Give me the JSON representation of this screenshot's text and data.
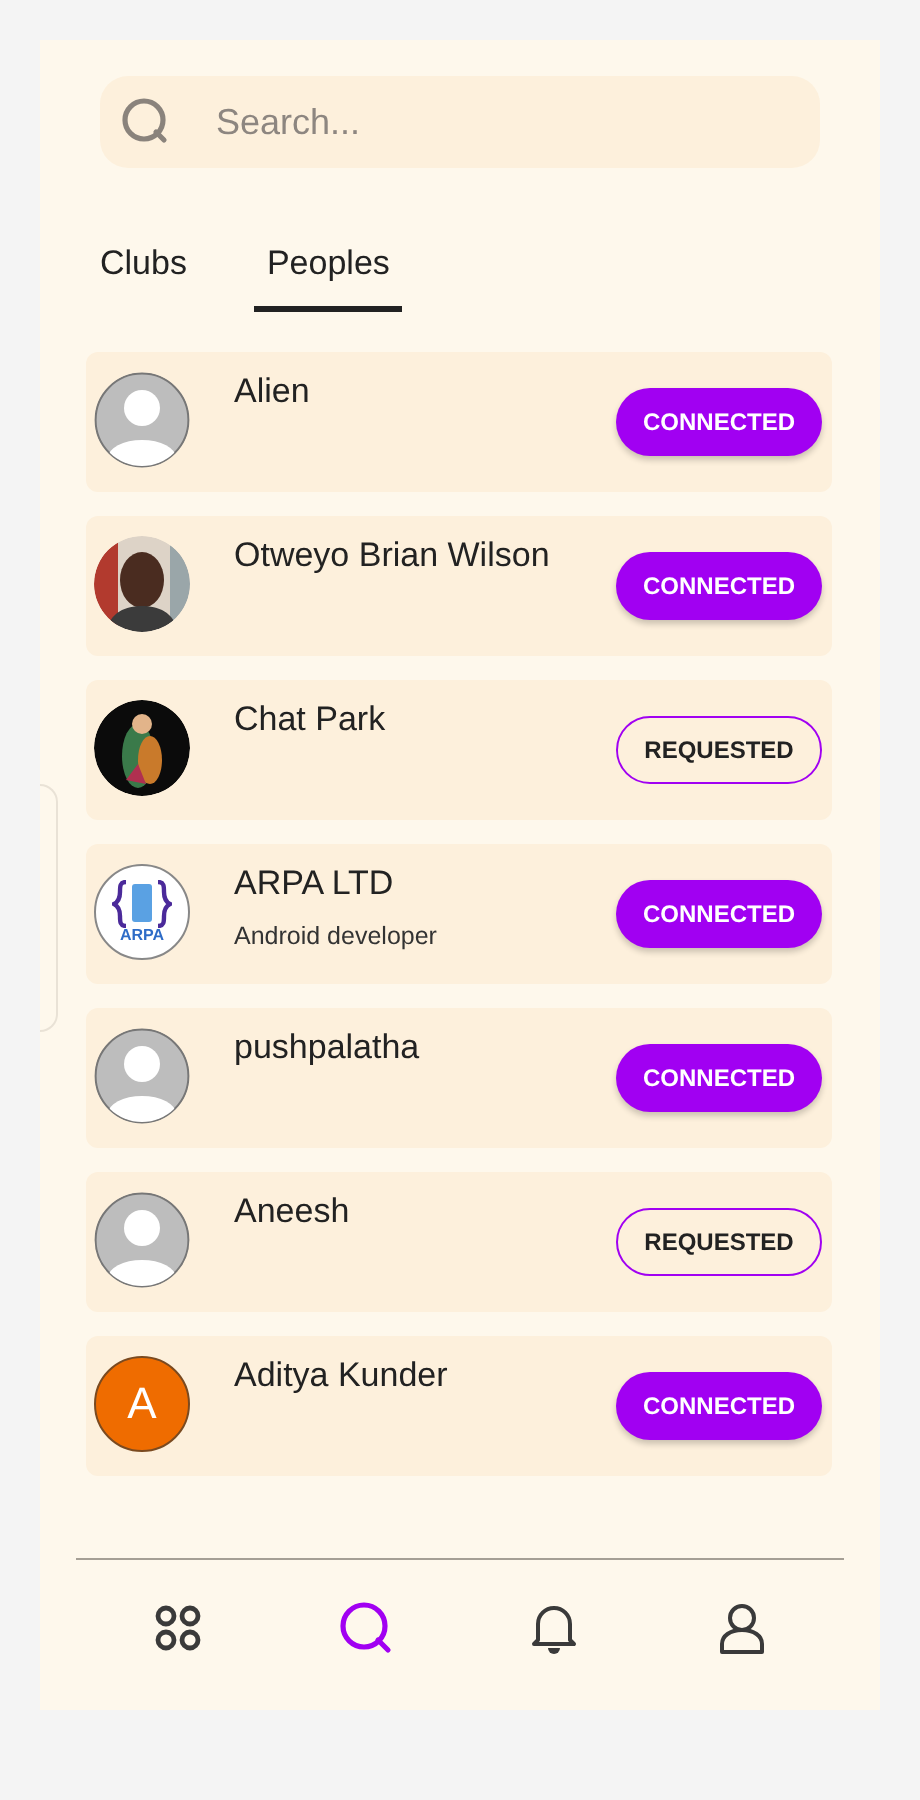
{
  "search": {
    "placeholder": "Search..."
  },
  "tabs": [
    {
      "label": "Clubs",
      "selected": false
    },
    {
      "label": "Peoples",
      "selected": true
    }
  ],
  "people": [
    {
      "name": "Alien",
      "avatar": {
        "kind": "placeholder"
      },
      "button": "CONNECTED",
      "connected": true
    },
    {
      "name": "Otweyo Brian Wilson",
      "button": "CONNECTED",
      "connected": true
    },
    {
      "name": "Chat Park",
      "button": "REQUESTED",
      "connected": false
    },
    {
      "name": "ARPA LTD",
      "subtitle": "Android developer",
      "avatar": {
        "kind": "logo",
        "text": "ARPA"
      },
      "button": "CONNECTED",
      "connected": true
    },
    {
      "name": "pushpalatha",
      "avatar": {
        "kind": "placeholder"
      },
      "button": "CONNECTED",
      "connected": true
    },
    {
      "name": "Aneesh",
      "avatar": {
        "kind": "placeholder"
      },
      "button": "REQUESTED",
      "connected": false
    },
    {
      "name": "Aditya Kunder",
      "avatar": {
        "kind": "initial",
        "text": "A",
        "color": "#ef6c00"
      },
      "button": "CONNECTED",
      "connected": true
    }
  ],
  "bottom_nav": [
    {
      "kind": "apps",
      "selected": false
    },
    {
      "kind": "search",
      "selected": true
    },
    {
      "kind": "notifications",
      "selected": false
    },
    {
      "kind": "profile",
      "selected": false
    }
  ]
}
